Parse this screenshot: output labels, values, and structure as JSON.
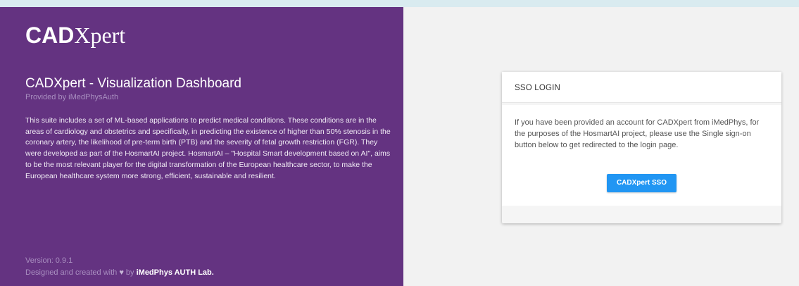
{
  "branding": {
    "logo_bold": "CAD",
    "logo_light": "Xpert"
  },
  "intro": {
    "title": "CADXpert - Visualization Dashboard",
    "provider": "Provided by iMedPhysAuth",
    "description": "This suite includes a set of ML-based applications to predict medical conditions. These conditions are in the areas of cardiology and obstetrics and specifically, in predicting the existence of higher than 50% stenosis in the coronary artery, the likelihood of pre-term birth (PTB) and the severity of fetal growth restriction (FGR). They were developed as part of the HosmartAI project. HosmartAI – \"Hospital Smart development based on AI\", aims to be the most relevant player for the digital transformation of the European healthcare sector, to make the European healthcare system more strong, efficient, sustainable and resilient."
  },
  "footer": {
    "version": "Version: 0.9.1",
    "credits_prefix": "Designed and created with",
    "heart_icon": "heart-icon",
    "credits_by": "by",
    "credits_lab": "iMedPhys AUTH Lab."
  },
  "login": {
    "title": "SSO LOGIN",
    "message": "If you have been provided an account for CADXpert from iMedPhys, for the purposes of the HosmartAI project, please use the Single sign-on button below to get redirected to the login page.",
    "button_label": "CADXpert SSO"
  },
  "colors": {
    "sidebar_background": "#643381",
    "page_background": "#f2f2f2",
    "top_strip": "#d9ebf0",
    "button": "#2196f3"
  }
}
